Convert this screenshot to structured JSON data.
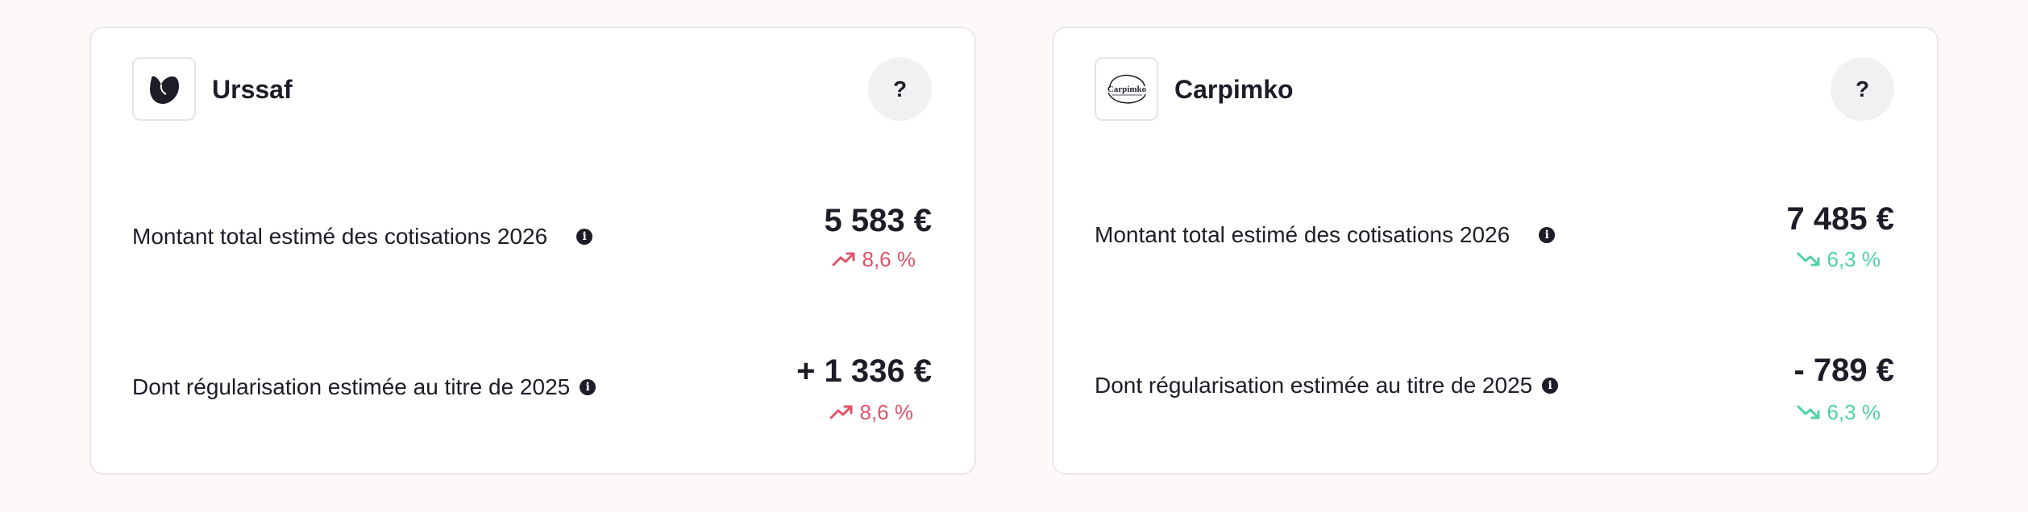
{
  "cards": [
    {
      "name": "Urssaf",
      "help_label": "?",
      "total_label": "Montant total estimé des cotisations 2026",
      "total_amount": "5 583 €",
      "total_trend": "8,6 %",
      "regul_label": "Dont régularisation estimée au titre de 2025",
      "regul_amount": "+ 1 336 €",
      "regul_trend": "8,6 %",
      "trend_direction": "up",
      "trend_color": "#e0536a"
    },
    {
      "name": "Carpimko",
      "logo_text": "Carpimko",
      "help_label": "?",
      "total_label": "Montant total estimé des cotisations 2026",
      "total_amount": "7 485 €",
      "total_trend": "6,3 %",
      "regul_label": "Dont régularisation estimée au titre de 2025",
      "regul_amount": "- 789 €",
      "regul_trend": "6,3 %",
      "trend_direction": "down",
      "trend_color": "#4fd2a2"
    }
  ],
  "icons": {
    "info": "info-icon",
    "trend_up": "trending-up-icon",
    "trend_down": "trending-down-icon"
  }
}
